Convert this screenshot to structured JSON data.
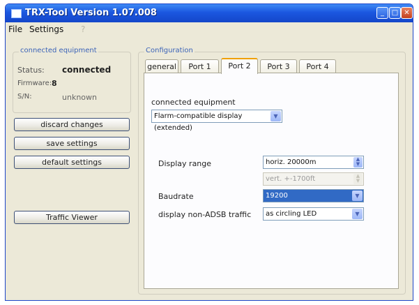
{
  "window": {
    "title": "TRX-Tool Version 1.07.008",
    "minimize_glyph": "_",
    "maximize_glyph": "□",
    "close_glyph": "✕"
  },
  "menu": {
    "file": "File",
    "settings": "Settings",
    "help": "?"
  },
  "left": {
    "group_title": "connected equipment",
    "status_label": "Status:",
    "status_value": "connected",
    "firmware_label": "Firmware:",
    "firmware_value": "8",
    "s_label": "S/N:",
    "s_value": "unknown",
    "discard_button": "discard changes",
    "save_button": "save settings",
    "default_button": "default settings",
    "traffic_button": "Traffic Viewer"
  },
  "config": {
    "group_title": "Configuration",
    "tabs": [
      "general",
      "Port 1",
      "Port 2",
      "Port 3",
      "Port 4"
    ],
    "active_tab": "Port 2",
    "equipment_label": "connected equipment",
    "equipment_value": "Flarm-compatible display (extended)",
    "display_range_label": "Display range",
    "horiz_value": "horiz. 20000m",
    "vert_value": "vert. +-1700ft",
    "baudrate_label": "Baudrate",
    "baudrate_value": "19200",
    "nonadsb_label": "display non-ADSB traffic",
    "nonadsb_value": "as circling LED"
  },
  "icons": {
    "dropdown": "▼",
    "spin_up": "▲",
    "spin_down": "▼"
  },
  "colors": {
    "titlebar": "#1b57e0",
    "selection": "#316ac5",
    "active_tab_accent": "#f0a000",
    "group_title": "#3b63b8"
  }
}
